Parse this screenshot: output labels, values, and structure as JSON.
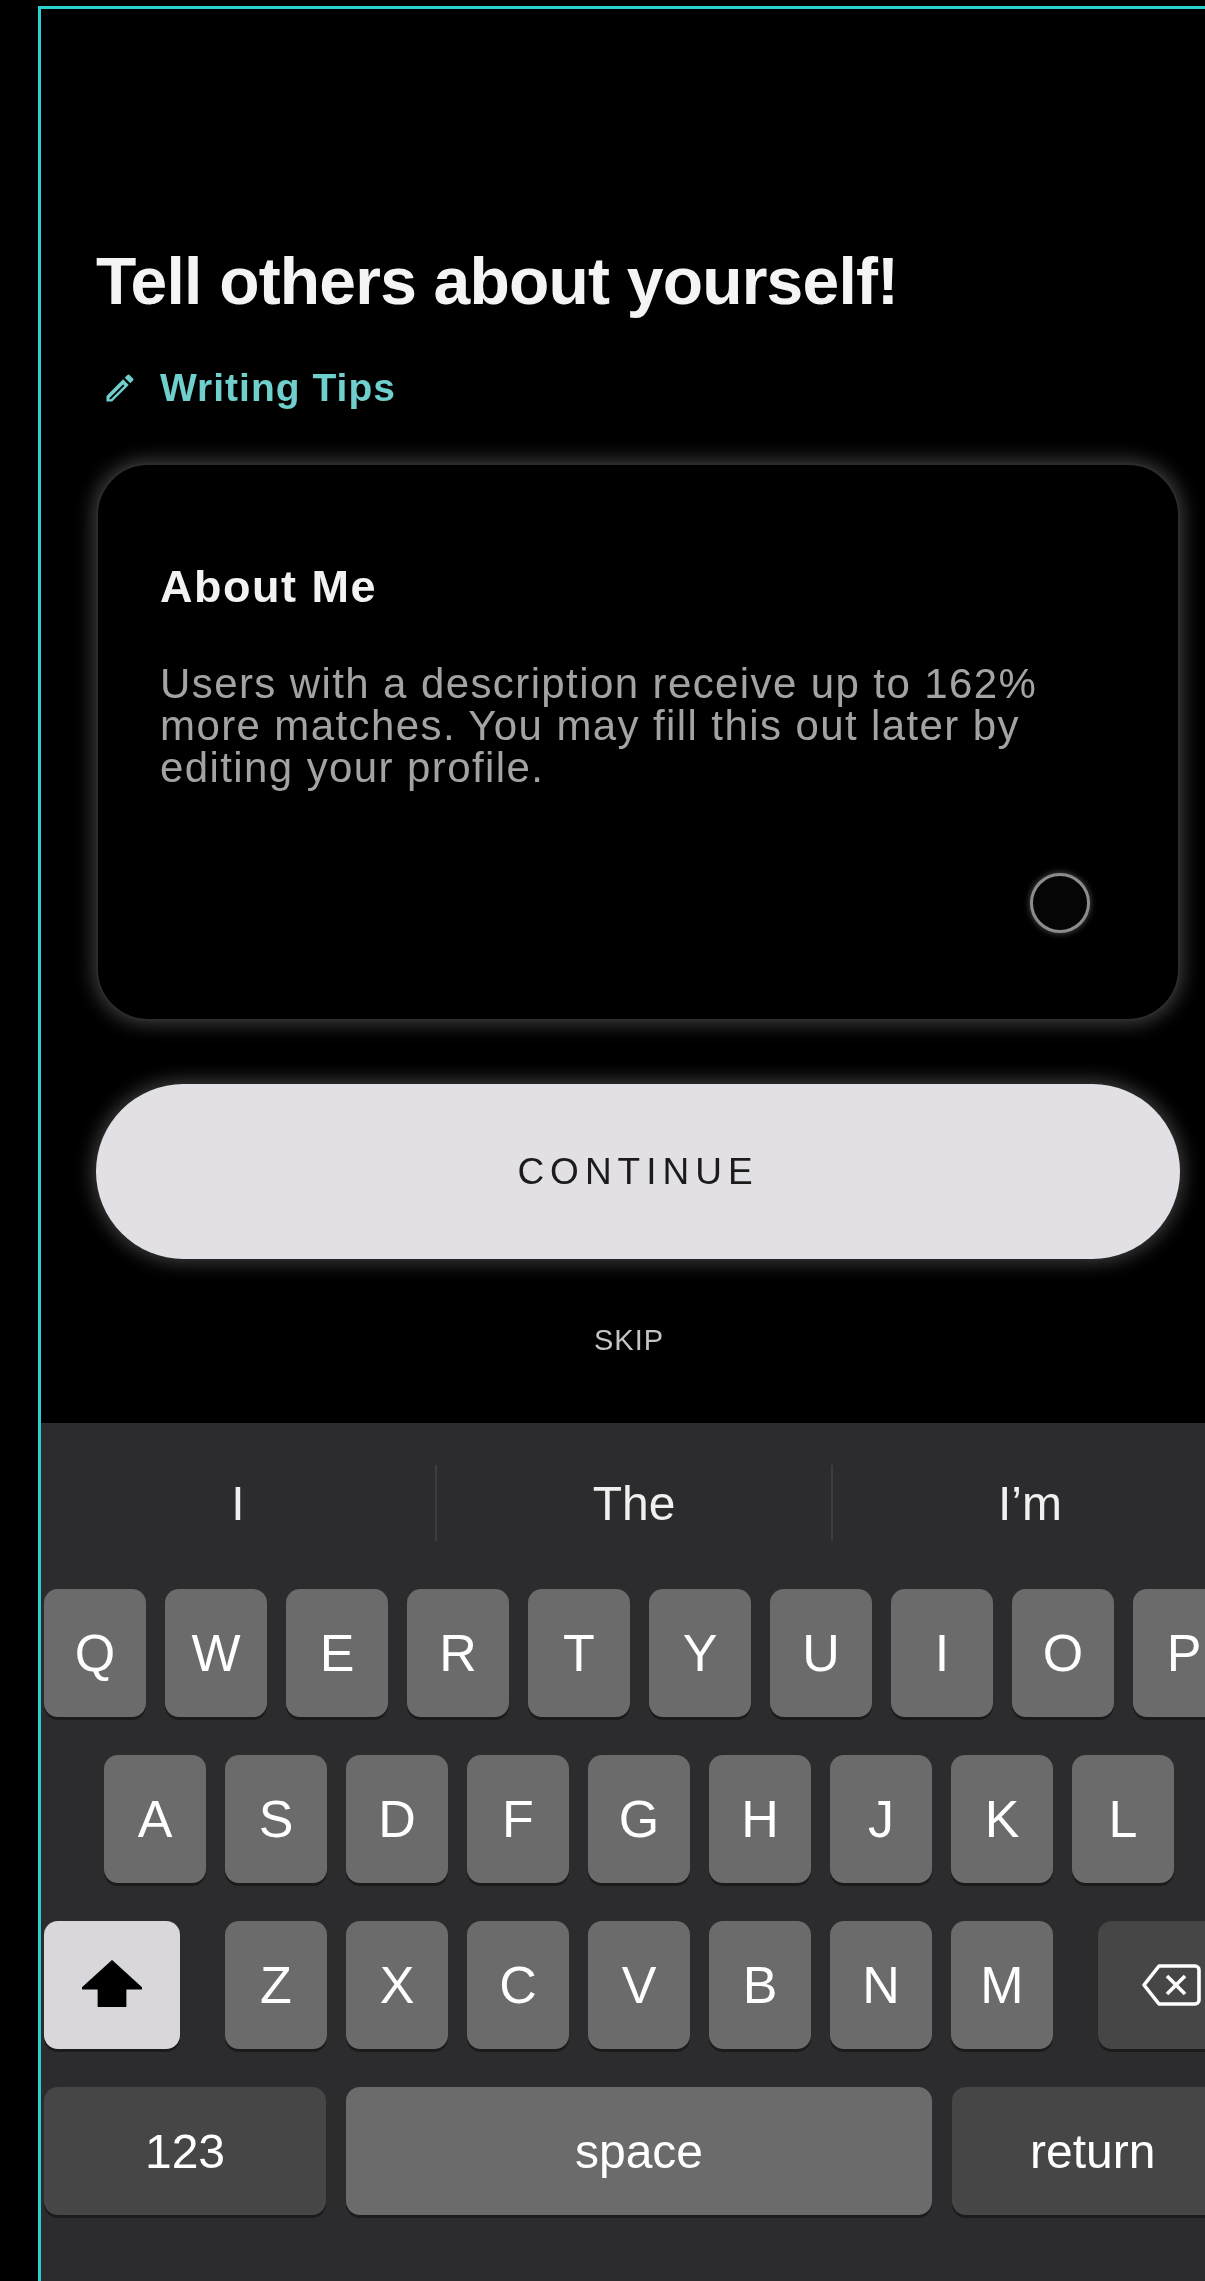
{
  "heading": "Tell others about yourself!",
  "tips_link": "Writing Tips",
  "about_card": {
    "title": "About Me",
    "placeholder": "Users with a description receive up to 162% more matches. You may fill this out later by editing your profile."
  },
  "continue_button": "CONTINUE",
  "skip_link": "SKIP",
  "keyboard": {
    "suggestions": [
      "I",
      "The",
      "I’m"
    ],
    "rows": [
      [
        {
          "kind": "letter",
          "label": "Q"
        },
        {
          "kind": "letter",
          "label": "W"
        },
        {
          "kind": "letter",
          "label": "E"
        },
        {
          "kind": "letter",
          "label": "R"
        },
        {
          "kind": "letter",
          "label": "T"
        },
        {
          "kind": "letter",
          "label": "Y"
        },
        {
          "kind": "letter",
          "label": "U"
        },
        {
          "kind": "letter",
          "label": "I"
        },
        {
          "kind": "letter",
          "label": "O"
        },
        {
          "kind": "letter",
          "label": "P"
        }
      ],
      [
        {
          "kind": "letter",
          "label": "A"
        },
        {
          "kind": "letter",
          "label": "S"
        },
        {
          "kind": "letter",
          "label": "D"
        },
        {
          "kind": "letter",
          "label": "F"
        },
        {
          "kind": "letter",
          "label": "G"
        },
        {
          "kind": "letter",
          "label": "H"
        },
        {
          "kind": "letter",
          "label": "J"
        },
        {
          "kind": "letter",
          "label": "K"
        },
        {
          "kind": "letter",
          "label": "L"
        }
      ],
      [
        {
          "kind": "shift",
          "on": true
        },
        {
          "kind": "letter",
          "label": "Z"
        },
        {
          "kind": "letter",
          "label": "X"
        },
        {
          "kind": "letter",
          "label": "C"
        },
        {
          "kind": "letter",
          "label": "V"
        },
        {
          "kind": "letter",
          "label": "B"
        },
        {
          "kind": "letter",
          "label": "N"
        },
        {
          "kind": "letter",
          "label": "M"
        },
        {
          "kind": "delete"
        }
      ]
    ],
    "bottom_bar": {
      "numbers_key": "123",
      "space_key": "space",
      "return_key": "return"
    }
  }
}
